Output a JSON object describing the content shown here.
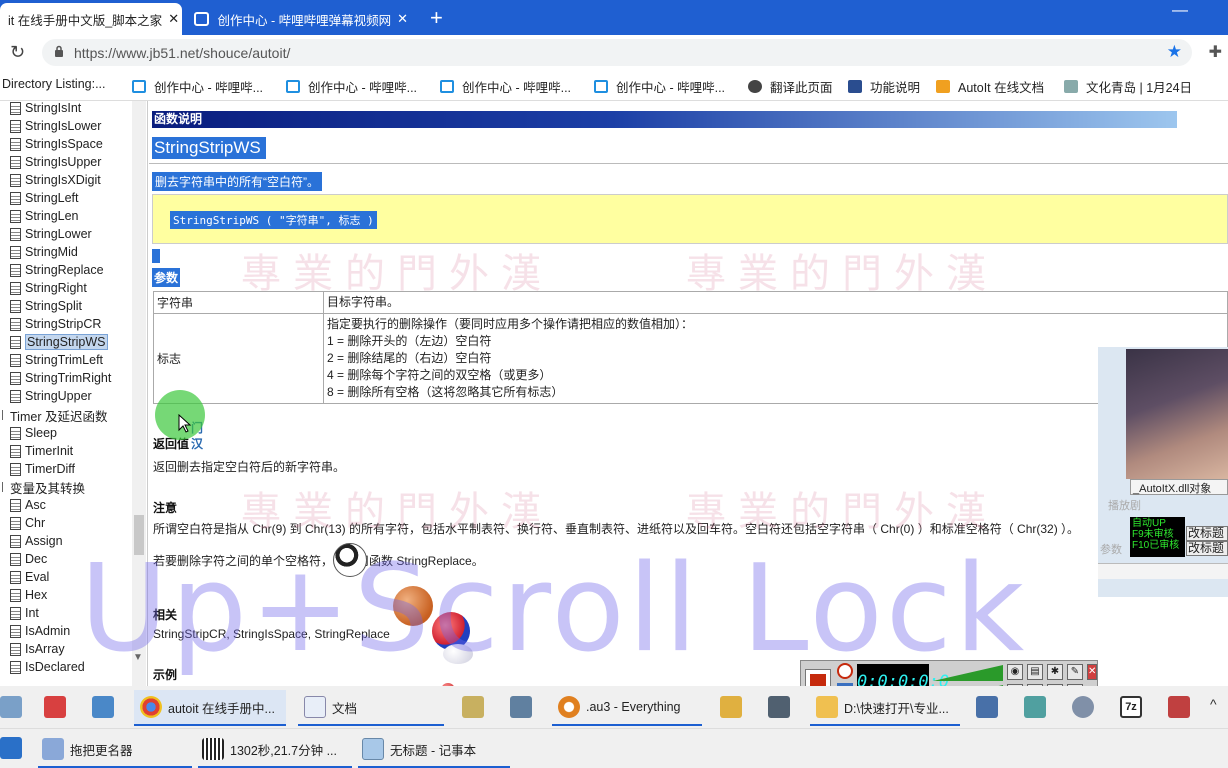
{
  "browser": {
    "tabs": [
      {
        "label": "it 在线手册中文版_脚本之家"
      },
      {
        "label": "创作中心 - 哔哩哔哩弹幕视频网"
      }
    ],
    "url": "https://www.jb51.net/shouce/autoit/"
  },
  "bookmarks": [
    "Directory Listing:...",
    "创作中心 - 哔哩哔...",
    "创作中心 - 哔哩哔...",
    "创作中心 - 哔哩哔...",
    "创作中心 - 哔哩哔...",
    "翻译此页面",
    "功能说明",
    "AutoIt 在线文档",
    "文化青岛 | 1月24日"
  ],
  "tree": {
    "items_top": [
      "StringIsInt",
      "StringIsLower",
      "StringIsSpace",
      "StringIsUpper",
      "StringIsXDigit",
      "StringLeft",
      "StringLen",
      "StringLower",
      "StringMid",
      "StringReplace",
      "StringRight",
      "StringSplit",
      "StringStripCR",
      "StringStripWS",
      "StringTrimLeft",
      "StringTrimRight",
      "StringUpper"
    ],
    "folder_timer": "Timer 及延迟函数",
    "items_timer": [
      "Sleep",
      "TimerInit",
      "TimerDiff"
    ],
    "folder_var": "变量及其转换",
    "items_var": [
      "Asc",
      "Chr",
      "Assign",
      "Dec",
      "Eval",
      "Hex",
      "Int",
      "IsAdmin",
      "IsArray",
      "IsDeclared"
    ],
    "selected": "StringStripWS"
  },
  "doc": {
    "section_bar": "函数说明",
    "function_name": "StringStripWS",
    "description": "删去字符串中的所有“空白符”。",
    "syntax": "StringStripWS ( \"字符串\", 标志 )",
    "params_heading": "参数",
    "params": [
      {
        "name": "字符串",
        "lines": [
          "目标字符串。"
        ]
      },
      {
        "name": "标志",
        "lines": [
          "指定要执行的删除操作（要同时应用多个操作请把相应的数值相加）：",
          "1 = 删除开头的（左边）空白符",
          "2 = 删除结尾的（右边）空白符",
          "4 = 删除每个字符之间的双空格（或更多）",
          "8 = 删除所有空格（这将忽略其它所有标志）"
        ]
      }
    ],
    "return_heading": "返回值",
    "return_text": "返回删去指定空白符后的新字符串。",
    "notes_heading": "注意",
    "notes_1": "所谓空白符是指从 Chr(9) 到 Chr(13) 的所有字符，包括水平制表符、换行符、垂直制表符、进纸符以及回车符。空白符还包括空字符串（ Chr(0) ）和标准空格符（ Chr(32) ）。",
    "notes_2": "若要删除字符之间的单个空格符，请使用函数 StringReplace。",
    "related_heading": "相关",
    "related_text": "StringStripCR, StringIsSpace, StringReplace",
    "example_heading": "示例",
    "cursor_tag_1": "门",
    "cursor_tag_2": "汉"
  },
  "watermark": "專業的門外漢",
  "overlay_text": "Up+Scroll Lock",
  "side_panel": {
    "autoitx": "_AutoItX.dll对象",
    "green_lines": [
      "自动UP",
      "F9未审核",
      "F10已审核"
    ],
    "buttons": [
      "改标题",
      "改标题"
    ],
    "faint": [
      "播放剧",
      "参数"
    ]
  },
  "recorder": {
    "counter": "0:0:0:0:0"
  },
  "taskbar_row1": [
    {
      "label": "autoit 在线手册中..."
    },
    {
      "label": "文档"
    },
    {
      "label": ".au3 - Everything"
    },
    {
      "label": "D:\\快速打开\\专业..."
    }
  ],
  "taskbar_row2": [
    {
      "label": "拖把更名器"
    },
    {
      "label": "1302秒,21.7分钟 ..."
    },
    {
      "label": "无标题 - 记事本"
    }
  ],
  "colors": {
    "accent": "#1f5fd1",
    "selection": "#2a72d8",
    "syntax_bg": "#ffffa0",
    "overlay": "#6e64eb"
  }
}
